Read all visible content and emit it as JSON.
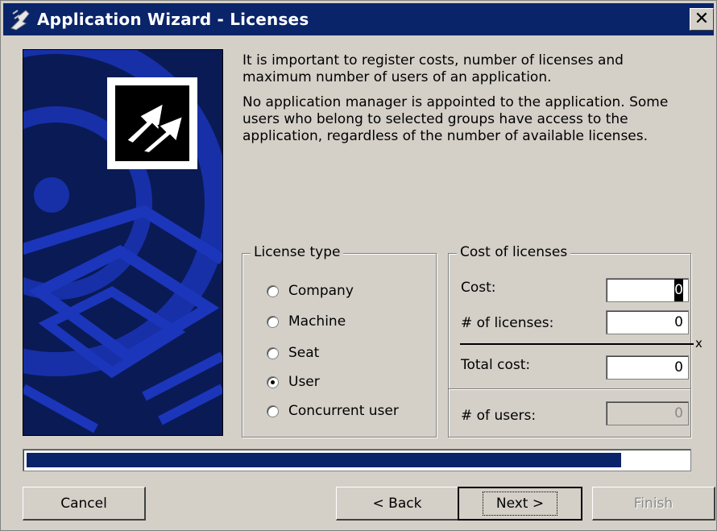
{
  "window": {
    "title": "Application Wizard - Licenses",
    "close_label": "✕"
  },
  "info": {
    "paragraph1": "It is important to register costs, number of licenses and maximum number of users of an application.",
    "paragraph2": "No application manager is appointed to the application. Some users who belong to selected groups have access to the application, regardless of the number of available licenses."
  },
  "license_type": {
    "legend": "License type",
    "options": [
      {
        "label": "Company",
        "checked": false
      },
      {
        "label": "Machine",
        "checked": false
      },
      {
        "label": "Seat",
        "checked": false
      },
      {
        "label": "User",
        "checked": true
      },
      {
        "label": "Concurrent user",
        "checked": false
      }
    ]
  },
  "cost": {
    "legend": "Cost of licenses",
    "cost_label": "Cost:",
    "cost_value": "0",
    "licenses_label": "# of licenses:",
    "licenses_value": "0",
    "times_symbol": "x",
    "total_label": "Total cost:",
    "total_value": "0",
    "users_label": "# of users:",
    "users_value": "0"
  },
  "progress": {
    "fraction": 0.9
  },
  "buttons": {
    "cancel": "Cancel",
    "back": "< Back",
    "next": "Next >",
    "finish": "Finish"
  },
  "icons": {
    "app_icon": "wizard-icon",
    "close": "close-icon",
    "logo": "arrows-logo-icon"
  },
  "colors": {
    "titlebar": "#0a246a",
    "progress": "#0a246a",
    "art_bg": "#0a1a55"
  }
}
